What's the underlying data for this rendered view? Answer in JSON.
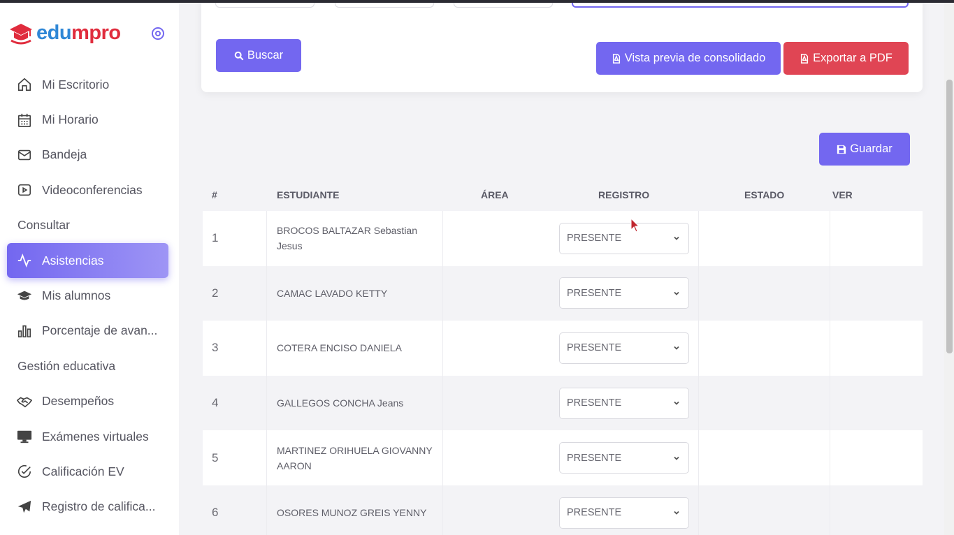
{
  "brand": {
    "edu": "edu",
    "mpro": "mpro",
    "primary": "#2f87d6",
    "secondary": "#e02c3d"
  },
  "accent": "#7367f0",
  "danger": "#e04554",
  "sidebar": {
    "items": [
      {
        "label": "Mi Escritorio",
        "icon": "home-icon"
      },
      {
        "label": "Mi Horario",
        "icon": "calendar-icon"
      },
      {
        "label": "Bandeja",
        "icon": "mail-icon"
      },
      {
        "label": "Videoconferencias",
        "icon": "video-icon"
      }
    ],
    "section_consultar": "Consultar",
    "items2": [
      {
        "label": "Asistencias",
        "icon": "activity-icon",
        "active": true
      },
      {
        "label": "Mis alumnos",
        "icon": "graduation-cap-icon"
      },
      {
        "label": "Porcentaje de avan...",
        "icon": "bar-chart-icon"
      }
    ],
    "section_gestion": "Gestión educativa",
    "items3": [
      {
        "label": "Desempeños",
        "icon": "handshake-icon"
      },
      {
        "label": "Exámenes virtuales",
        "icon": "monitor-icon"
      },
      {
        "label": "Calificación EV",
        "icon": "check-circle-icon"
      },
      {
        "label": "Registro de califica...",
        "icon": "send-icon"
      }
    ]
  },
  "buttons": {
    "buscar": "Buscar",
    "vista_previa": "Vista previa de consolidado",
    "exportar": "Exportar a PDF",
    "guardar": "Guardar"
  },
  "table": {
    "headers": [
      "#",
      "ESTUDIANTE",
      "ÁREA",
      "REGISTRO",
      "ESTADO",
      "VER"
    ],
    "rows": [
      {
        "n": "1",
        "student": "BROCOS BALTAZAR Sebastian Jesus",
        "registro": "PRESENTE"
      },
      {
        "n": "2",
        "student": "CAMAC LAVADO KETTY",
        "registro": "PRESENTE"
      },
      {
        "n": "3",
        "student": "COTERA ENCISO DANIELA",
        "registro": "PRESENTE"
      },
      {
        "n": "4",
        "student": "GALLEGOS CONCHA Jeans",
        "registro": "PRESENTE"
      },
      {
        "n": "5",
        "student": "MARTINEZ ORIHUELA GIOVANNY AARON",
        "registro": "PRESENTE"
      },
      {
        "n": "6",
        "student": "OSORES MUNOZ GREIS YENNY",
        "registro": "PRESENTE"
      }
    ]
  }
}
